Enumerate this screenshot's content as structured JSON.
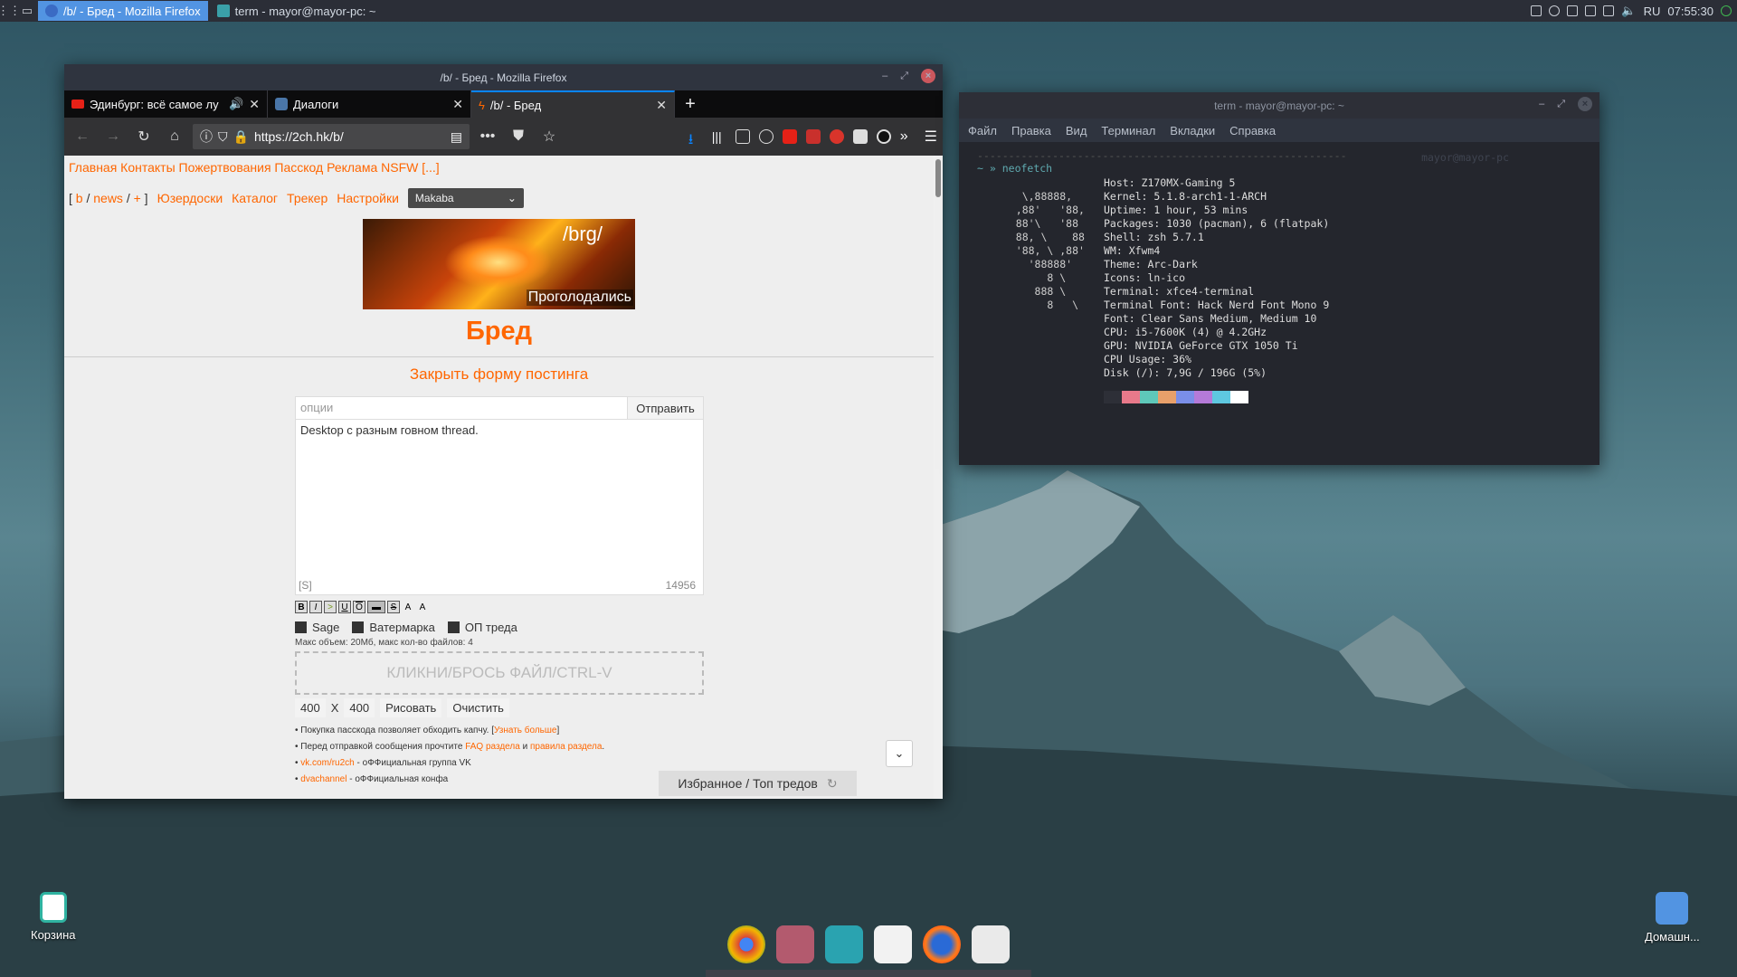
{
  "panel": {
    "tasks": [
      {
        "label": "/b/ - Бред - Mozilla Firefox",
        "active": true
      },
      {
        "label": "term - mayor@mayor-pc: ~",
        "active": false
      }
    ],
    "lang": "RU",
    "clock": "07:55:30"
  },
  "firefox": {
    "title": "/b/ - Бред - Mozilla Firefox",
    "tabs": [
      {
        "label": "Эдинбург: всё самое лу",
        "icon": "youtube-icon"
      },
      {
        "label": "Диалоги",
        "icon": "chat-icon"
      },
      {
        "label": "/b/ - Бред",
        "icon": "bolt-icon"
      }
    ],
    "url": "https://2ch.hk/b/"
  },
  "page": {
    "toplinks": "Главная Контакты Пожертвования Пасскод Реклама NSFW [...]",
    "nav": {
      "b": "b",
      "news": "news",
      "plus": "+",
      "userboards": "Юзердоски",
      "catalog": "Каталог",
      "tracker": "Трекер",
      "settings": "Настройки",
      "style": "Makaba"
    },
    "banner": {
      "board": "/brg/",
      "caption": "Проголодались"
    },
    "title": "Бред",
    "close_form": "Закрыть форму постинга",
    "form": {
      "options_placeholder": "опции",
      "send": "Отправить",
      "text": "Desktop с разным говном thread.",
      "spoiler": "[S]",
      "counter": "14956",
      "markup": [
        "B",
        "I",
        ">",
        "U",
        "O",
        "▬",
        "S",
        "A",
        "A"
      ],
      "checks": [
        "Sage",
        "Ватермарка",
        "ОП треда"
      ],
      "limits": "Макс объем: 20Мб, макс кол-во файлов: 4",
      "dropzone": "КЛИКНИ/БРОСЬ ФАЙЛ/CTRL-V",
      "w": "400",
      "x": "X",
      "h": "400",
      "draw": "Рисовать",
      "clear": "Очистить"
    },
    "rules": {
      "r1a": "• Покупка пасскода позволяет обходить капчу. [",
      "r1link": "Узнать больше",
      "r1b": "]",
      "r2a": "• Перед отправкой сообщения прочтите ",
      "r2link1": "FAQ раздела",
      "r2mid": " и ",
      "r2link2": "правила раздела",
      "r2b": ".",
      "r3link": "vk.com/ru2ch",
      "r3b": " - оФФициальная группа VK",
      "r4link": "dvachannel",
      "r4b": " - оФФициальная конфа"
    },
    "favorites": "Избранное / Топ тредов"
  },
  "terminal": {
    "title": "term - mayor@mayor-pc: ~",
    "menu": [
      "Файл",
      "Правка",
      "Вид",
      "Терминал",
      "Вкладки",
      "Справка"
    ],
    "dashes": "-----------------------------------------------------------",
    "prompt": "~ »",
    "command": "neofetch",
    "host_right": "mayor@mayor-pc",
    "logo": "\n    \\,88888,\n   ,88'   '88,\n   88'\\   '88\n   88, \\    88\n   '88, \\ ,88'\n     '88888'\n        8 \\\n      888 \\\n        8   \\",
    "info": "Host: Z170MX-Gaming 5\nKernel: 5.1.8-arch1-1-ARCH\nUptime: 1 hour, 53 mins\nPackages: 1030 (pacman), 6 (flatpak)\nShell: zsh 5.7.1\nWM: Xfwm4\nTheme: Arc-Dark\nIcons: ln-ico\nTerminal: xfce4-terminal\nTerminal Font: Hack Nerd Font Mono 9\nFont: Clear Sans Medium, Medium 10\nCPU: i5-7600K (4) @ 4.2GHz\nGPU: NVIDIA GeForce GTX 1050 Ti\nCPU Usage: 36%\nDisk (/): 7,9G / 196G (5%)",
    "swatches": [
      "#2d2f37",
      "#e8798a",
      "#5ec8b9",
      "#e8a06a",
      "#7a8ee8",
      "#b57ad8",
      "#5ec8e0",
      "#ffffff"
    ]
  },
  "desktop": {
    "trash": "Корзина",
    "home": "Домашн..."
  }
}
